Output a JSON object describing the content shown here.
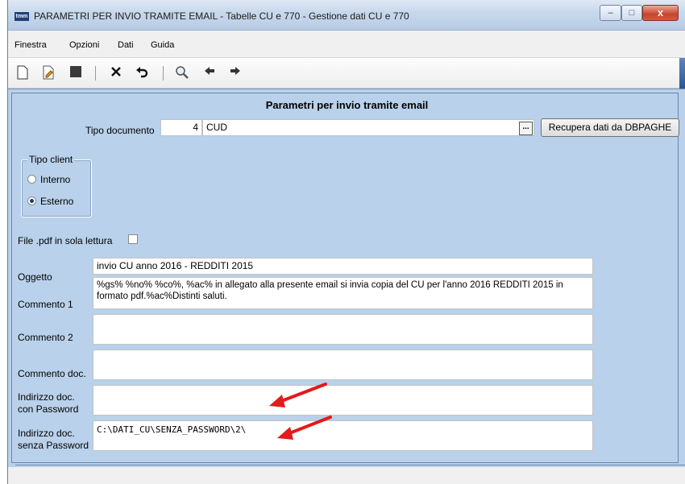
{
  "window": {
    "app_icon": "tmm",
    "title": "PARAMETRI PER INVIO TRAMITE EMAIL - Tabelle CU e 770 - Gestione dati CU e 770",
    "controls": {
      "minimize": "–",
      "maximize": "□",
      "close": "x"
    }
  },
  "menubar": {
    "items": [
      "Finestra",
      "Opzioni",
      "Dati",
      "Guida"
    ]
  },
  "toolbar": {
    "icons": [
      "new-document-icon",
      "edit-document-icon",
      "save-icon",
      "delete-icon",
      "undo-icon",
      "search-icon",
      "arrow-left-icon",
      "arrow-right-icon"
    ]
  },
  "form": {
    "title": "Parametri per invio tramite email",
    "tipo_documento": {
      "label": "Tipo documento",
      "code": "4",
      "name": "CUD"
    },
    "lookup_button": "...",
    "recupera_button": "Recupera dati da DBPAGHE",
    "tipo_client": {
      "legend": "Tipo client",
      "options": [
        {
          "label": "Interno",
          "selected": false
        },
        {
          "label": "Esterno",
          "selected": true
        }
      ]
    },
    "pdf_readonly": {
      "label": "File .pdf in sola lettura",
      "checked": false
    },
    "oggetto": {
      "label": "Oggetto",
      "value": "invio CU anno 2016 - REDDITI 2015"
    },
    "commento1": {
      "label": "Commento 1",
      "value_line1": "%gs% %no% %co%, %ac%  in allegato alla presente email si invia copia del CU per l'anno 2016  REDDITI 2015 in",
      "value_line2": "formato pdf.%ac%Distinti saluti."
    },
    "commento2": {
      "label": "Commento 2",
      "value": ""
    },
    "commento_doc": {
      "label": "Commento doc.",
      "value": ""
    },
    "indirizzo_con_pw": {
      "label_line1": "Indirizzo doc.",
      "label_line2": "con Password",
      "value": ""
    },
    "indirizzo_senza_pw": {
      "label_line1": "Indirizzo doc.",
      "label_line2": "senza Password",
      "value": "C:\\DATI_CU\\SENZA_PASSWORD\\2\\"
    }
  },
  "colors": {
    "form_bg": "#b9d1ea",
    "arrow": "#e21b1b"
  }
}
